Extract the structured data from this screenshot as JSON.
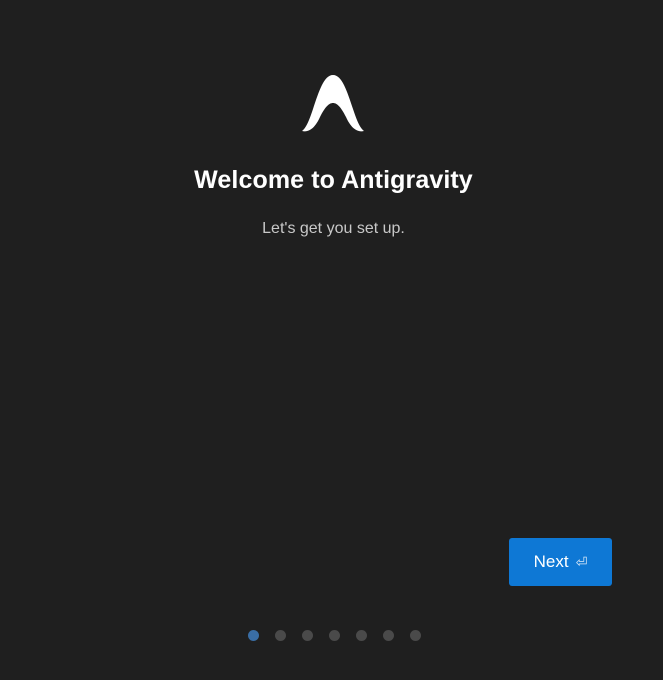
{
  "welcome": {
    "logo_icon": "antigravity-logo-icon",
    "title": "Welcome to Antigravity",
    "subtitle": "Let's get you set up."
  },
  "actions": {
    "next_label": "Next",
    "next_icon": "enter-key-icon",
    "next_glyph": "⏎",
    "accent_color": "#0e78d5"
  },
  "pagination": {
    "total_steps": 7,
    "current_step": 1,
    "active_color": "#3a6ea5",
    "inactive_color": "#4a4a4a"
  }
}
